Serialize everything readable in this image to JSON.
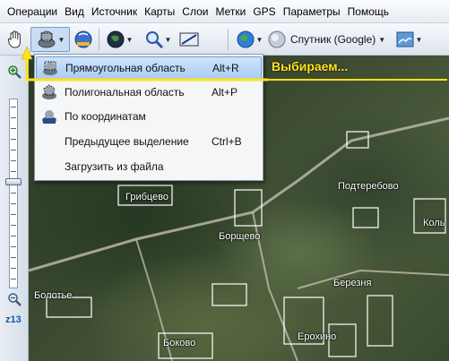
{
  "menubar": {
    "items": [
      "Операции",
      "Вид",
      "Источник",
      "Карты",
      "Слои",
      "Метки",
      "GPS",
      "Параметры",
      "Помощь"
    ]
  },
  "toolbar": {
    "map_source_label": "Спутник (Google)",
    "icons": [
      "hand-icon",
      "selection-icon",
      "connection-icon",
      "earth-icon",
      "zoom-icon",
      "gps-icon",
      "globe-icon",
      "satellite-icon",
      "layers-icon"
    ]
  },
  "dropdown": {
    "items": [
      {
        "label": "Прямоугольная область",
        "shortcut": "Alt+R",
        "highlighted": true
      },
      {
        "label": "Полигональная область",
        "shortcut": "Alt+P",
        "highlighted": false
      },
      {
        "label": "По координатам",
        "shortcut": "",
        "highlighted": false
      },
      {
        "label": "Предыдущее выделение",
        "shortcut": "Ctrl+B",
        "highlighted": false
      },
      {
        "label": "Загрузить из файла",
        "shortcut": "",
        "highlighted": false
      }
    ]
  },
  "annotation": {
    "text": "Выбираем...",
    "color": "#ffe21a"
  },
  "zoom": {
    "label": "z13"
  },
  "map": {
    "places": [
      "Подтеребово",
      "Грибцево",
      "Борщево",
      "Коль",
      "Березня",
      "Болотье",
      "Боково",
      "Ерохино"
    ]
  }
}
